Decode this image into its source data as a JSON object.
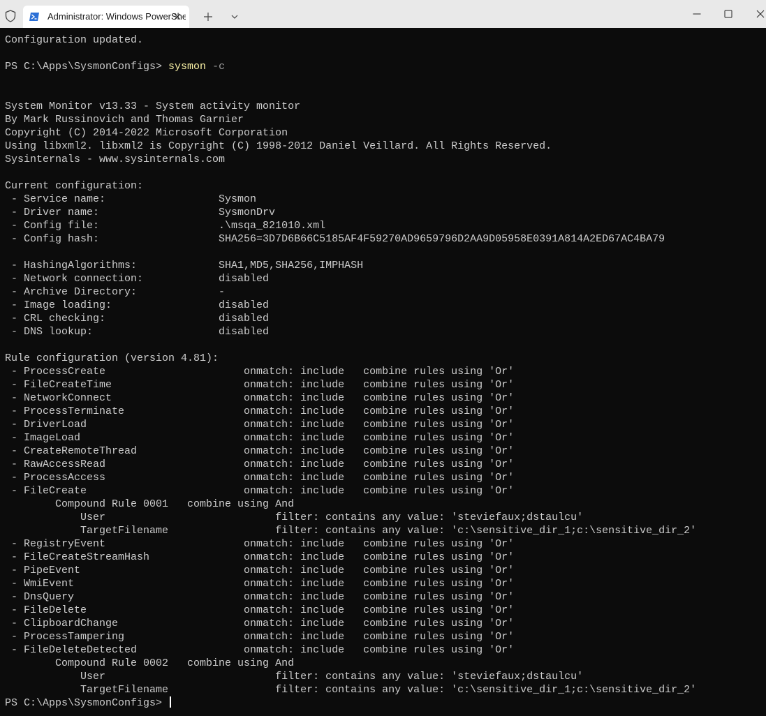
{
  "window": {
    "tab_title": "Administrator: Windows PowerShell",
    "icons": {
      "shield": "shield-icon",
      "tab": "powershell-icon",
      "close_tab": "close-icon",
      "new_tab": "plus-icon",
      "dropdown": "chevron-down-icon",
      "minimize": "minimize-icon",
      "maximize": "maximize-icon",
      "close_window": "close-icon"
    }
  },
  "colors": {
    "background": "#0c0c0c",
    "foreground": "#cccccc",
    "command": "#f9f1a5",
    "parameter": "#9d9d9d",
    "titlebar": "#e9e9e9"
  },
  "terminal": {
    "lines": [
      "Configuration updated.",
      "",
      "",
      "",
      "",
      "System Monitor v13.33 - System activity monitor",
      "By Mark Russinovich and Thomas Garnier",
      "Copyright (C) 2014-2022 Microsoft Corporation",
      "Using libxml2. libxml2 is Copyright (C) 1998-2012 Daniel Veillard. All Rights Reserved.",
      "Sysinternals - www.sysinternals.com",
      "",
      "Current configuration:",
      " - Service name:                  Sysmon",
      " - Driver name:                   SysmonDrv",
      " - Config file:                   .\\msqa_821010.xml",
      " - Config hash:                   SHA256=3D7D6B66C5185AF4F59270AD9659796D2AA9D05958E0391A814A2ED67AC4BA79",
      "",
      " - HashingAlgorithms:             SHA1,MD5,SHA256,IMPHASH",
      " - Network connection:            disabled",
      " - Archive Directory:             -",
      " - Image loading:                 disabled",
      " - CRL checking:                  disabled",
      " - DNS lookup:                    disabled",
      "",
      "Rule configuration (version 4.81):",
      " - ProcessCreate                      onmatch: include   combine rules using 'Or'",
      " - FileCreateTime                     onmatch: include   combine rules using 'Or'",
      " - NetworkConnect                     onmatch: include   combine rules using 'Or'",
      " - ProcessTerminate                   onmatch: include   combine rules using 'Or'",
      " - DriverLoad                         onmatch: include   combine rules using 'Or'",
      " - ImageLoad                          onmatch: include   combine rules using 'Or'",
      " - CreateRemoteThread                 onmatch: include   combine rules using 'Or'",
      " - RawAccessRead                      onmatch: include   combine rules using 'Or'",
      " - ProcessAccess                      onmatch: include   combine rules using 'Or'",
      " - FileCreate                         onmatch: include   combine rules using 'Or'",
      "        Compound Rule 0001   combine using And",
      "            User                           filter: contains any value: 'steviefaux;dstaulcu'",
      "            TargetFilename                 filter: contains any value: 'c:\\sensitive_dir_1;c:\\sensitive_dir_2'",
      " - RegistryEvent                      onmatch: include   combine rules using 'Or'",
      " - FileCreateStreamHash               onmatch: include   combine rules using 'Or'",
      " - PipeEvent                          onmatch: include   combine rules using 'Or'",
      " - WmiEvent                           onmatch: include   combine rules using 'Or'",
      " - DnsQuery                           onmatch: include   combine rules using 'Or'",
      " - FileDelete                         onmatch: include   combine rules using 'Or'",
      " - ClipboardChange                    onmatch: include   combine rules using 'Or'",
      " - ProcessTampering                   onmatch: include   combine rules using 'Or'",
      " - FileDeleteDetected                 onmatch: include   combine rules using 'Or'",
      "        Compound Rule 0002   combine using And",
      "            User                           filter: contains any value: 'steviefaux;dstaulcu'",
      "            TargetFilename                 filter: contains any value: 'c:\\sensitive_dir_1;c:\\sensitive_dir_2'"
    ],
    "command_line": {
      "prompt": "PS C:\\Apps\\SysmonConfigs> ",
      "command": "sysmon",
      "argument": "-c"
    },
    "final_prompt": "PS C:\\Apps\\SysmonConfigs> "
  }
}
